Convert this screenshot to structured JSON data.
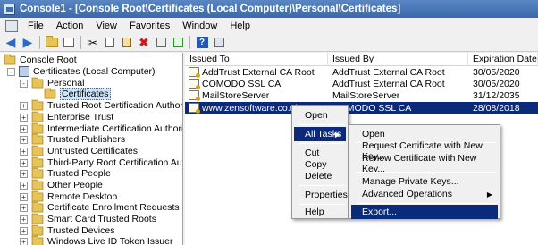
{
  "window": {
    "title": "Console1 - [Console Root\\Certificates (Local Computer)\\Personal\\Certificates]"
  },
  "menubar": [
    "File",
    "Action",
    "View",
    "Favorites",
    "Window",
    "Help"
  ],
  "tree": {
    "root": "Console Root",
    "store": "Certificates (Local Computer)",
    "personal": "Personal",
    "certificates": "Certificates",
    "items": [
      "Trusted Root Certification Authorities",
      "Enterprise Trust",
      "Intermediate Certification Authorities",
      "Trusted Publishers",
      "Untrusted Certificates",
      "Third-Party Root Certification Authorities",
      "Trusted People",
      "Other People",
      "Remote Desktop",
      "Certificate Enrollment Requests",
      "Smart Card Trusted Roots",
      "Trusted Devices",
      "Windows Live ID Token Issuer"
    ]
  },
  "list": {
    "columns": [
      "Issued To",
      "Issued By",
      "Expiration Date"
    ],
    "rows": [
      {
        "issued_to": "AddTrust External CA Root",
        "issued_by": "AddTrust External CA Root",
        "expiration": "30/05/2020"
      },
      {
        "issued_to": "COMODO SSL CA",
        "issued_by": "AddTrust External CA Root",
        "expiration": "30/05/2020"
      },
      {
        "issued_to": "MailStoreServer",
        "issued_by": "MailStoreServer",
        "expiration": "31/12/2035"
      },
      {
        "issued_to": "www.zensoftware.co.uk",
        "issued_by": "COMODO SSL CA",
        "expiration": "28/08/2018"
      }
    ]
  },
  "context_menu": {
    "open": "Open",
    "all_tasks": "All Tasks",
    "cut": "Cut",
    "copy": "Copy",
    "delete": "Delete",
    "properties": "Properties",
    "help": "Help"
  },
  "submenu": {
    "open": "Open",
    "request_new_key": "Request Certificate with New Key...",
    "renew_new_key": "Renew Certificate with New Key...",
    "manage_private_keys": "Manage Private Keys...",
    "advanced_operations": "Advanced Operations",
    "export": "Export..."
  },
  "colors": {
    "selection": "#0b2a7a",
    "title_bar": "#4a7bbd"
  }
}
